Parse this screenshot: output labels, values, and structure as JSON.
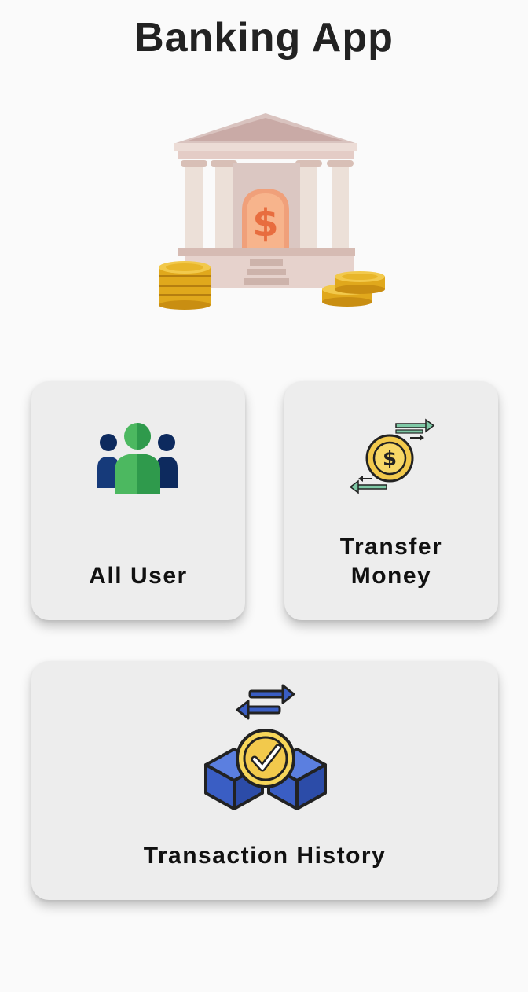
{
  "app": {
    "title": "Banking App"
  },
  "hero": {
    "icon": "bank-building-icon"
  },
  "cards": {
    "all_user": {
      "label": "All User",
      "icon": "users-group-icon"
    },
    "transfer_money": {
      "label_line1": "Transfer",
      "label_line2": "Money",
      "icon": "money-transfer-icon"
    },
    "transaction_history": {
      "label": "Transaction History",
      "icon": "transaction-history-icon"
    }
  },
  "colors": {
    "background": "#fafafa",
    "card": "#ededed",
    "text": "#111111",
    "coin_gold": "#f2c94c",
    "user_green": "#4cb860",
    "user_navy": "#0d2a5e",
    "block_blue": "#3a5ec4"
  }
}
